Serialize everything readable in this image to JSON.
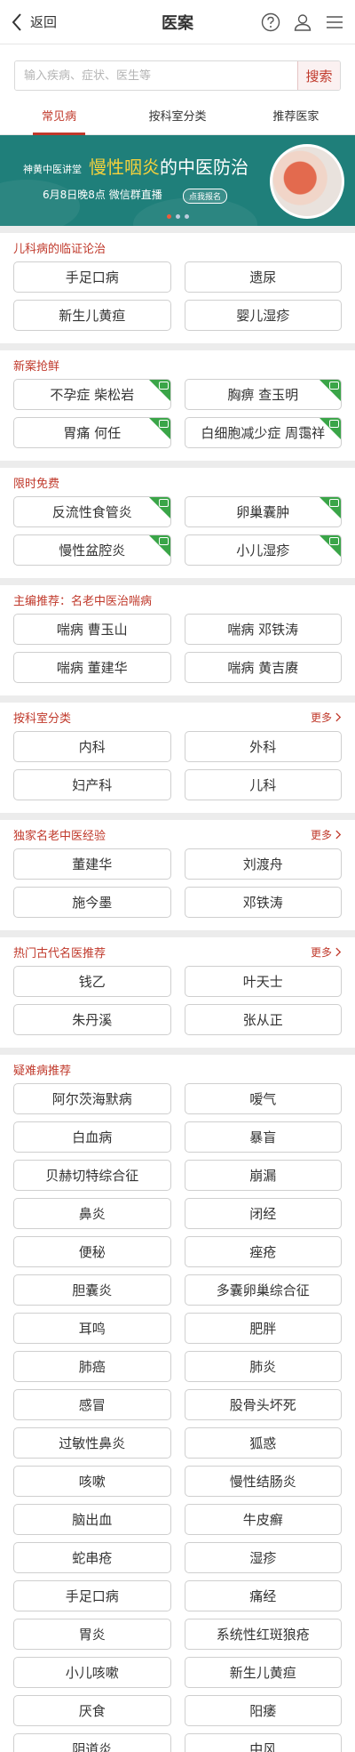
{
  "header": {
    "back_label": "返回",
    "title": "医案"
  },
  "search": {
    "placeholder": "输入疾病、症状、医生等",
    "button_label": "搜索"
  },
  "tabs": [
    {
      "label": "常见病",
      "active": true
    },
    {
      "label": "按科室分类",
      "active": false
    },
    {
      "label": "推荐医家",
      "active": false
    }
  ],
  "banner": {
    "brand": "神黄中医讲堂",
    "headline_highlight": "慢性咽炎",
    "headline_rest": "的中医防治",
    "date_text": "6月8日晚8点  微信群直播",
    "cta": "点我报名",
    "active_dot": 0,
    "dot_count": 3
  },
  "sections": {
    "pediatric": {
      "title": "儿科病的临证论治",
      "items": [
        "手足口病",
        "遗尿",
        "新生儿黄疸",
        "婴儿湿疹"
      ]
    },
    "fresh": {
      "title": "新案抢鲜",
      "items": [
        "不孕症 柴松岩",
        "胸痹 查玉明",
        "胃痛 何任",
        "白细胞减少症 周霭祥"
      ]
    },
    "free": {
      "title": "限时免费",
      "items": [
        "反流性食管炎",
        "卵巢囊肿",
        "慢性盆腔炎",
        "小儿湿疹"
      ]
    },
    "editor": {
      "title": "主编推荐：名老中医治喘病",
      "items": [
        "喘病 曹玉山",
        "喘病 邓铁涛",
        "喘病 董建华",
        "喘病 黄吉赓"
      ]
    },
    "departments": {
      "title": "按科室分类",
      "more": "更多",
      "items": [
        "内科",
        "外科",
        "妇产科",
        "儿科"
      ]
    },
    "experience": {
      "title": "独家名老中医经验",
      "more": "更多",
      "items": [
        "董建华",
        "刘渡舟",
        "施今墨",
        "邓铁涛"
      ]
    },
    "ancient": {
      "title": "热门古代名医推荐",
      "more": "更多",
      "items": [
        "钱乙",
        "叶天士",
        "朱丹溪",
        "张从正"
      ]
    },
    "difficult": {
      "title": "疑难病推荐",
      "items": [
        "阿尔茨海默病",
        "嗳气",
        "白血病",
        "暴盲",
        "贝赫切特综合征",
        "崩漏",
        "鼻炎",
        "闭经",
        "便秘",
        "痤疮",
        "胆囊炎",
        "多囊卵巢综合征",
        "耳鸣",
        "肥胖",
        "肺癌",
        "肺炎",
        "感冒",
        "股骨头坏死",
        "过敏性鼻炎",
        "狐惑",
        "咳嗽",
        "慢性结肠炎",
        "脑出血",
        "牛皮癣",
        "蛇串疮",
        "湿疹",
        "手足口病",
        "痛经",
        "胃炎",
        "系统性红斑狼疮",
        "小儿咳嗽",
        "新生儿黄疸",
        "厌食",
        "阳痿",
        "阴道炎",
        "中风"
      ]
    }
  },
  "colors": {
    "accent": "#c0392b",
    "banner_bg": "#1f7f7a",
    "ribbon": "#3aa548",
    "highlight": "#f4d13c"
  },
  "icons": {
    "back": "chevron-left-icon",
    "help": "question-circle-icon",
    "user": "user-icon",
    "menu": "hamburger-menu-icon",
    "more": "chevron-right-icon",
    "ribbon": "video-ribbon-icon"
  }
}
